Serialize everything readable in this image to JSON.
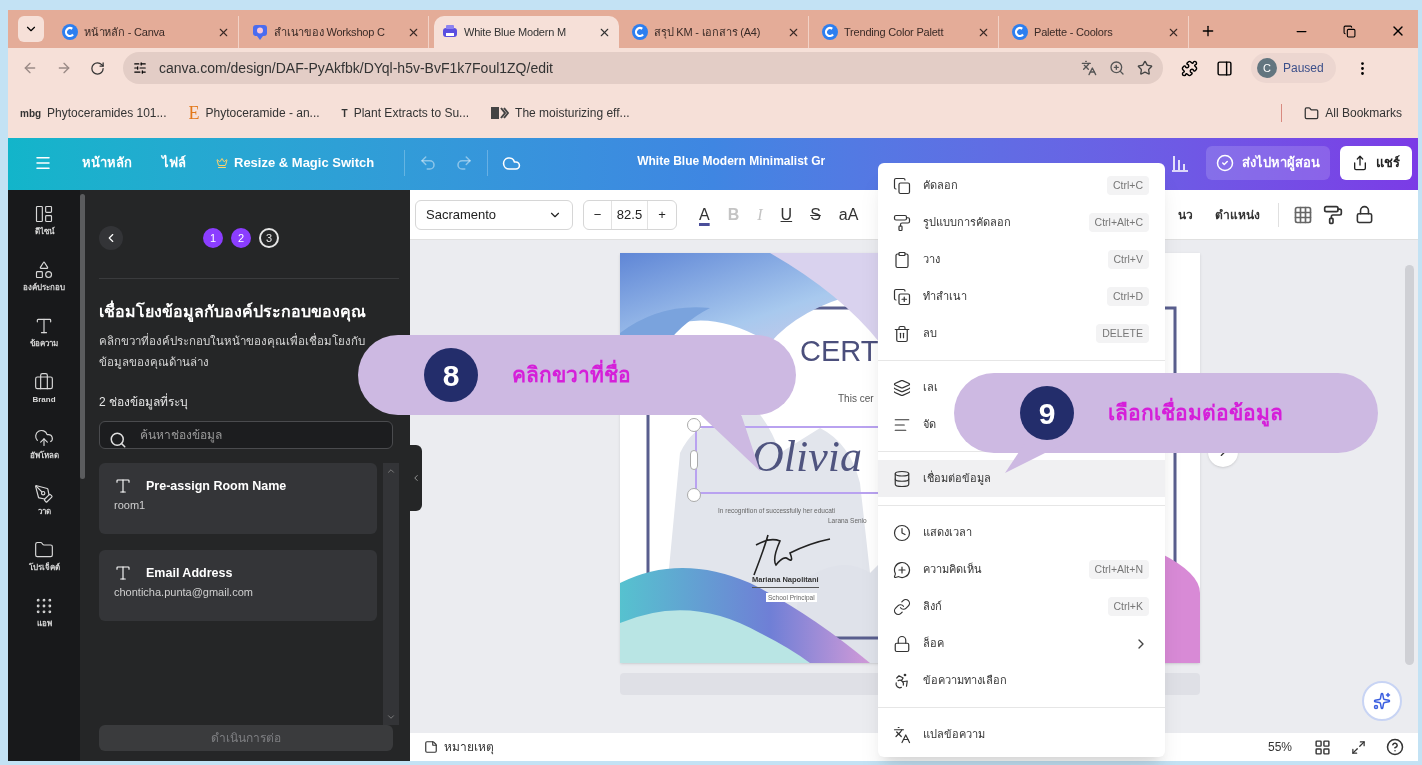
{
  "browser": {
    "tabs": [
      {
        "title": "หน้าหลัก - Canva",
        "selected": false
      },
      {
        "title": "สำเนาของ Workshop C",
        "selected": false
      },
      {
        "title": "White Blue Modern M",
        "selected": true
      },
      {
        "title": "สรุป KM - เอกสาร (A4)",
        "selected": false
      },
      {
        "title": "Trending Color Palett",
        "selected": false
      },
      {
        "title": "Palette - Coolors",
        "selected": false
      }
    ],
    "address": "canva.com/design/DAF-PyAkfbk/DYql-h5v-BvF1k7Foul1ZQ/edit",
    "profile": {
      "initial": "C",
      "status": "Paused"
    },
    "bookmarks": [
      {
        "icon_text": "mbg",
        "title": "Phytoceramides 101..."
      },
      {
        "icon_text": "E",
        "title": "Phytoceramide - an..."
      },
      {
        "icon_text": "T",
        "title": "Plant Extracts to Su..."
      },
      {
        "title": "The moisturizing eff..."
      }
    ],
    "all_bookmarks": "All Bookmarks"
  },
  "header": {
    "nav": [
      "หน้าหลัก",
      "ไฟล์"
    ],
    "resize": "Resize & Magic Switch",
    "title": "White Blue Modern Minimalist Gr",
    "submit": "ส่งไปหาผู้สอน",
    "share": "แชร์"
  },
  "rail": [
    {
      "label": "ดีไซน์"
    },
    {
      "label": "องค์ประกอบ"
    },
    {
      "label": "ข้อความ"
    },
    {
      "label": "Brand"
    },
    {
      "label": "อัพโหลด"
    },
    {
      "label": "วาด"
    },
    {
      "label": "โปรเจ็คต์"
    },
    {
      "label": "แอพ"
    }
  ],
  "panel": {
    "steps": [
      {
        "label": "1",
        "done": true
      },
      {
        "label": "2",
        "done": true
      },
      {
        "label": "3",
        "done": false
      }
    ],
    "title": "เชื่อมโยงข้อมูลกับองค์ประกอบของคุณ",
    "description": "คลิกขวาที่องค์ประกอบในหน้าของคุณเพื่อเชื่อมโยงกับข้อมูลของคุณด้านล่าง",
    "count": "2 ช่องข้อมูลที่ระบุ",
    "search": {
      "placeholder": "ค้นหาช่องข้อมูล"
    },
    "fields": [
      {
        "name": "Pre-assign Room Name",
        "value": "room1"
      },
      {
        "name": "Email Address",
        "value": "chonticha.punta@gmail.com"
      }
    ],
    "continue": {
      "label": "ดำเนินการต่อ",
      "disabled": true
    }
  },
  "toolbar": {
    "font": "Sacramento",
    "minus": "−",
    "size": "82.5",
    "plus": "+",
    "format": [
      {
        "label": "A",
        "kind": "color",
        "disabled": false
      },
      {
        "label": "B",
        "kind": "bold",
        "disabled": true
      },
      {
        "label": "I",
        "kind": "italic",
        "disabled": true
      },
      {
        "label": "U",
        "kind": "underline",
        "disabled": false
      },
      {
        "label": "S",
        "kind": "strike",
        "disabled": false
      },
      {
        "label": "aA",
        "kind": "case",
        "disabled": false
      }
    ],
    "cut_label": "นว",
    "position": "ตำแหน่ง"
  },
  "certificate": {
    "heading": "CERT",
    "subtitle": "This cer",
    "name": "Olivia",
    "recognition": "In recognition of successfully her educati",
    "school": "Larana Senio",
    "signer": "Mariana Napolitani",
    "role": "School Principal"
  },
  "context_menu": [
    {
      "kind": "item",
      "label": "คัดลอก",
      "shortcut": "Ctrl+C",
      "selected": false
    },
    {
      "kind": "item",
      "label": "รูปแบบการคัดลอก",
      "shortcut": "Ctrl+Alt+C",
      "selected": false
    },
    {
      "kind": "item",
      "label": "วาง",
      "shortcut": "Ctrl+V",
      "selected": false
    },
    {
      "kind": "item",
      "label": "ทำสำเนา",
      "shortcut": "Ctrl+D",
      "selected": false
    },
    {
      "kind": "item",
      "label": "ลบ",
      "shortcut": "DELETE",
      "selected": false
    },
    {
      "kind": "separator"
    },
    {
      "kind": "item",
      "label": "เลเ",
      "selected": false
    },
    {
      "kind": "item",
      "label": "จัด",
      "selected": false
    },
    {
      "kind": "separator"
    },
    {
      "kind": "item",
      "label": "เชื่อมต่อข้อมูล",
      "selected": true
    },
    {
      "kind": "separator"
    },
    {
      "kind": "item",
      "label": "แสดงเวลา",
      "selected": false
    },
    {
      "kind": "item",
      "label": "ความคิดเห็น",
      "shortcut": "Ctrl+Alt+N",
      "selected": false
    },
    {
      "kind": "item",
      "label": "ลิงก์",
      "shortcut": "Ctrl+K",
      "selected": false
    },
    {
      "kind": "submenu",
      "label": "ล็อค",
      "selected": false
    },
    {
      "kind": "item",
      "label": "ข้อความทางเลือก",
      "selected": false
    },
    {
      "kind": "separator"
    },
    {
      "kind": "item",
      "label": "แปลข้อความ",
      "selected": false
    }
  ],
  "callouts": [
    {
      "number": "8",
      "text": "คลิกขวาที่ชื่อ"
    },
    {
      "number": "9",
      "text": "เลือกเชื่อมต่อข้อมูล"
    }
  ],
  "footer": {
    "notes": "หมายเหตุ",
    "zoom": "55%"
  }
}
